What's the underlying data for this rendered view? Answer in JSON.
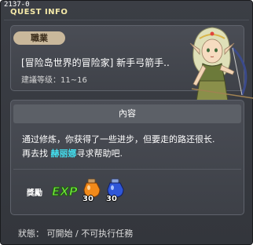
{
  "window": {
    "quest_id": "2137-0",
    "title": "QUEST INFO"
  },
  "quest": {
    "job_tag": "職業",
    "name": "[冒险岛世界的冒险家] 新手弓箭手..",
    "level": "建議等级：11~16"
  },
  "content": {
    "header": "內容",
    "line1": "通过修炼，你获得了一些进步，但要走的路还很长.",
    "line2_prefix": "再去找 ",
    "npc": "赫丽娜",
    "line2_suffix": "寻求帮助吧."
  },
  "rewards": {
    "label": "獎勵",
    "exp_text": "EXP",
    "items": [
      {
        "icon": "orange-potion-icon",
        "count": "30"
      },
      {
        "icon": "blue-potion-icon",
        "count": "30"
      }
    ]
  },
  "status": {
    "label": "狀態",
    "value": "可開始",
    "separator": "/",
    "action": "不可执行任務"
  },
  "colors": {
    "title": "#f4e9a8",
    "npc_name": "#43e0f0",
    "job_tag": "#c9b89b",
    "exp_green": "#6fe33a"
  }
}
